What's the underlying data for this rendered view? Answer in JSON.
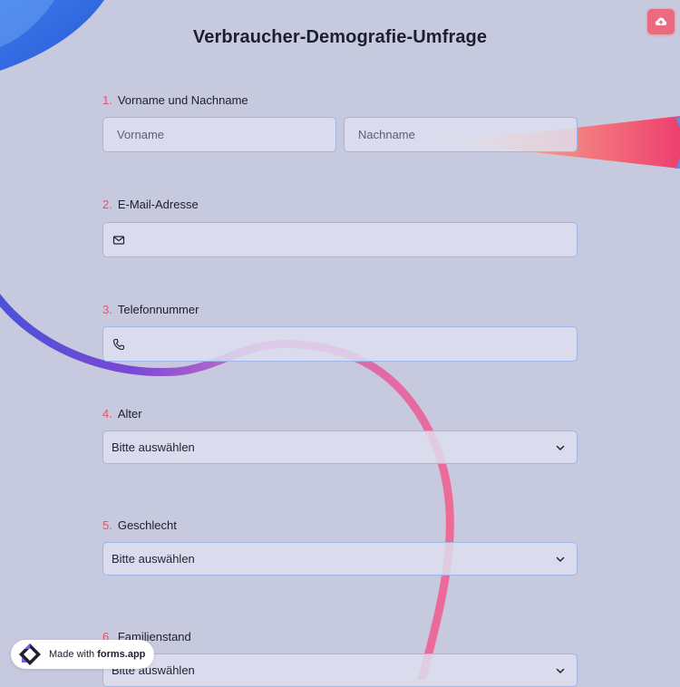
{
  "title": "Verbraucher-Demografie-Umfrage",
  "questions": {
    "q1": {
      "num": "1.",
      "label": "Vorname und Nachname",
      "first_placeholder": "Vorname",
      "last_placeholder": "Nachname"
    },
    "q2": {
      "num": "2.",
      "label": "E-Mail-Adresse",
      "icon": "mail-icon"
    },
    "q3": {
      "num": "3.",
      "label": "Telefonnummer",
      "icon": "phone-icon"
    },
    "q4": {
      "num": "4.",
      "label": "Alter",
      "value": "Bitte auswählen"
    },
    "q5": {
      "num": "5.",
      "label": "Geschlecht",
      "value": "Bitte auswählen"
    },
    "q6": {
      "num": "6.",
      "label": "Familienstand",
      "value": "Bitte auswählen"
    }
  },
  "badge": {
    "prefix": "Made with ",
    "brand": "forms.app"
  },
  "colors": {
    "accent": "#e0566d",
    "upload_button": "#ea6b7f",
    "background": "#c7c9df",
    "field_border": "#9db6e6"
  }
}
